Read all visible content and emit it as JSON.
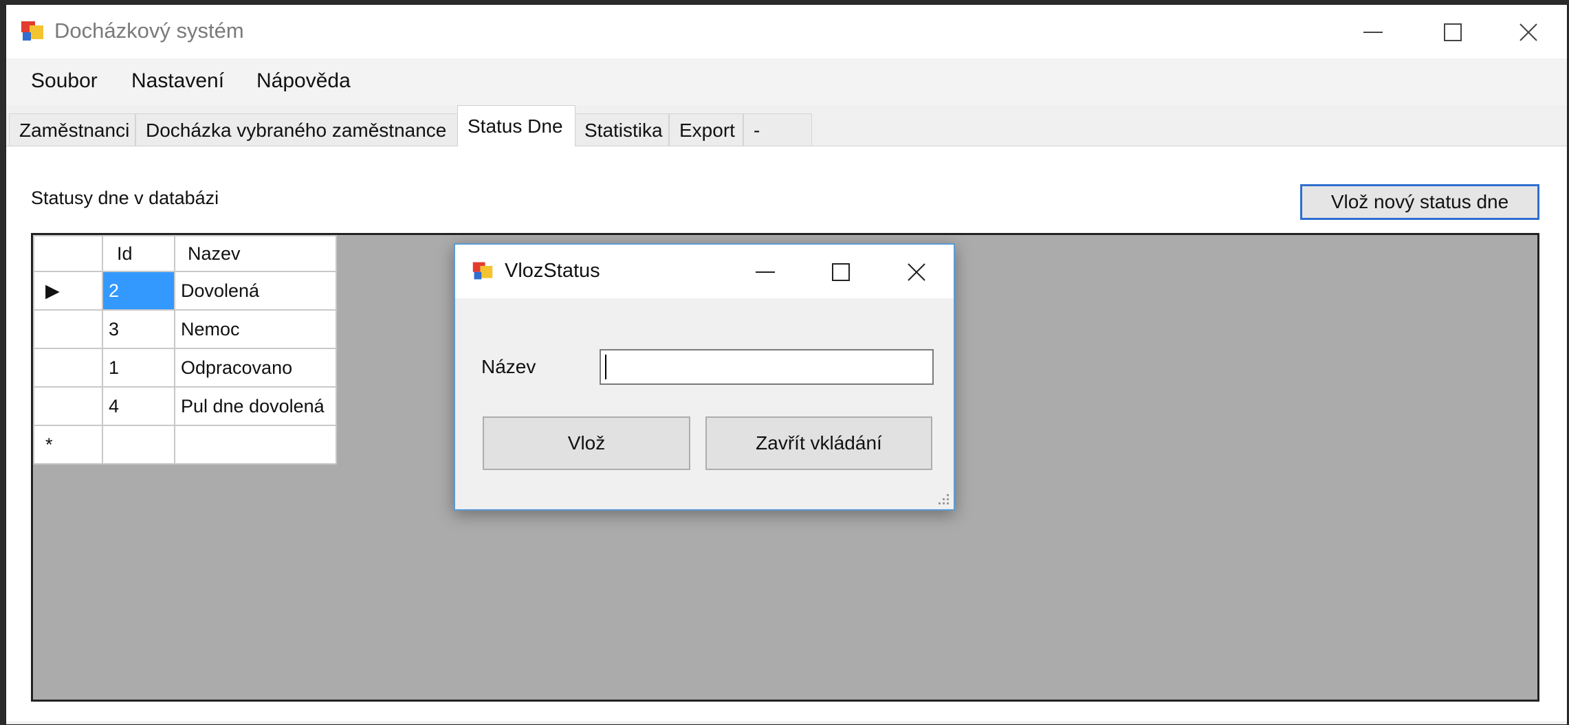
{
  "window": {
    "title": "Docházkový systém",
    "icon": "app-window-icon"
  },
  "menu": {
    "items": [
      "Soubor",
      "Nastavení",
      "Nápověda"
    ]
  },
  "tabs": [
    "Zaměstnanci",
    "Docházka vybraného zaměstnance",
    "Status Dne",
    "Statistika",
    "Export",
    "-"
  ],
  "active_tab": "Status Dne",
  "panel": {
    "label": "Statusy dne v databázi",
    "add_button": "Vlož nový status dne"
  },
  "grid": {
    "columns": [
      "Id",
      "Nazev"
    ],
    "rows": [
      {
        "marker": "▶",
        "id": "2",
        "name": "Dovolená",
        "selected": true
      },
      {
        "marker": "",
        "id": "3",
        "name": "Nemoc"
      },
      {
        "marker": "",
        "id": "1",
        "name": "Odpracovano"
      },
      {
        "marker": "",
        "id": "4",
        "name": "Pul dne dovolená"
      },
      {
        "marker": "*",
        "id": "",
        "name": ""
      }
    ]
  },
  "dialog": {
    "title": "VlozStatus",
    "field_label": "Název",
    "field_value": "",
    "insert_button": "Vlož",
    "close_button": "Zavřít vkládání"
  },
  "colors": {
    "selection": "#3399ff",
    "focus_border": "#2f6fd0",
    "grid_background": "#ababab"
  }
}
